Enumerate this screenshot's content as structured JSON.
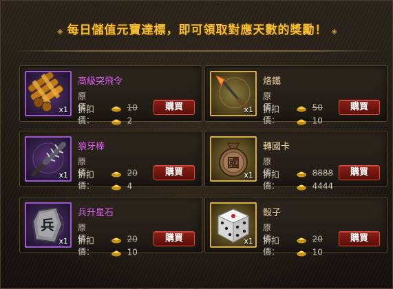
{
  "header": {
    "title": "每日儲值元寶達標，即可領取對應天數的獎勵！"
  },
  "labels": {
    "original_price": "原　價：",
    "discount_price": "折扣價："
  },
  "items": [
    {
      "name": "高級突飛令",
      "rarity": "purple",
      "icon": "scroll-bundle-icon",
      "qty": "x1",
      "original": "10",
      "discount": "2",
      "buy": "購買"
    },
    {
      "name": "烙鐵",
      "rarity": "gold",
      "icon": "branding-iron-icon",
      "qty": "x1",
      "original": "50",
      "discount": "10",
      "buy": "購買"
    },
    {
      "name": "狼牙棒",
      "rarity": "purple",
      "icon": "spiked-club-icon",
      "qty": "x1",
      "original": "20",
      "discount": "4",
      "buy": "購買"
    },
    {
      "name": "轉國卡",
      "rarity": "gold",
      "icon": "nation-token-icon",
      "qty": "x1",
      "original": "8888",
      "discount": "4444",
      "buy": "購買"
    },
    {
      "name": "兵升星石",
      "rarity": "purple",
      "icon": "rune-stone-icon",
      "qty": "x1",
      "original": "20",
      "discount": "10",
      "buy": "購買"
    },
    {
      "name": "骰子",
      "rarity": "gold",
      "icon": "dice-icon",
      "qty": "x1",
      "original": "20",
      "discount": "10",
      "buy": "購買"
    }
  ],
  "token_glyph": "國",
  "stone_glyph": "兵",
  "colors": {
    "title": "#f5c030",
    "purple_name": "#dd5cf2",
    "gold_name": "#f0d6a0",
    "buy_button": "#8c1e15"
  }
}
